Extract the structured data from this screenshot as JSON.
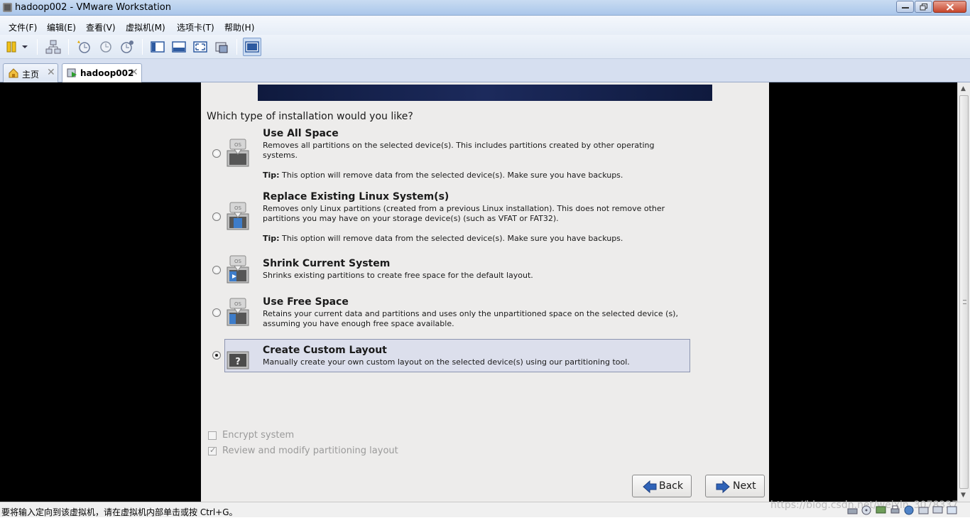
{
  "window": {
    "title": "hadoop002 - VMware Workstation"
  },
  "menu": [
    {
      "label": "文件(F)"
    },
    {
      "label": "编辑(E)"
    },
    {
      "label": "查看(V)"
    },
    {
      "label": "虚拟机(M)"
    },
    {
      "label": "选项卡(T)"
    },
    {
      "label": "帮助(H)"
    }
  ],
  "toolbar": {
    "icons": [
      "power-icon",
      "dropdown-arrow-icon",
      "network-icon",
      "snapshot-take-icon",
      "snapshot-revert-icon",
      "snapshot-manager-icon",
      "sidebar-view-icon",
      "tab-view-icon",
      "fullscreen-icon",
      "unity-icon",
      "console-view-icon"
    ]
  },
  "tabs": [
    {
      "label": "主页",
      "icon": "home-icon"
    },
    {
      "label": "hadoop002",
      "icon": "vm-play-icon"
    }
  ],
  "installer": {
    "question": "Which type of installation would you like?",
    "options": [
      {
        "title": "Use All Space",
        "description": "Removes all partitions on the selected device(s).  This includes partitions created by other operating systems.",
        "tip_label": "Tip:",
        "tip": " This option will remove data from the selected device(s).  Make sure you have backups.",
        "selected": false
      },
      {
        "title": "Replace Existing Linux System(s)",
        "description": "Removes only Linux partitions (created from a previous Linux installation).  This does not remove other partitions you may have on your storage device(s) (such as VFAT or FAT32).",
        "tip_label": "Tip:",
        "tip": " This option will remove data from the selected device(s).  Make sure you have backups.",
        "selected": false
      },
      {
        "title": "Shrink Current System",
        "description": "Shrinks existing partitions to create free space for the default layout.",
        "selected": false
      },
      {
        "title": "Use Free Space",
        "description": "Retains your current data and partitions and uses only the unpartitioned space on the selected device (s), assuming you have enough free space available.",
        "selected": false
      },
      {
        "title": "Create Custom Layout",
        "description": "Manually create your own custom layout on the selected device(s) using our partitioning tool.",
        "selected": true
      }
    ],
    "os_icon_text": "OS",
    "custom_icon_text": "?",
    "encrypt": {
      "label": "Encrypt system",
      "checked": false
    },
    "review": {
      "label": "Review and modify partitioning layout",
      "checked": true
    },
    "back_label": "Back",
    "next_label": "Next"
  },
  "status": {
    "message": "要将输入定向到该虚拟机，请在虚拟机内部单击或按 Ctrl+G。",
    "watermark": "https://blog.csdn.net/weixin_3078337"
  }
}
